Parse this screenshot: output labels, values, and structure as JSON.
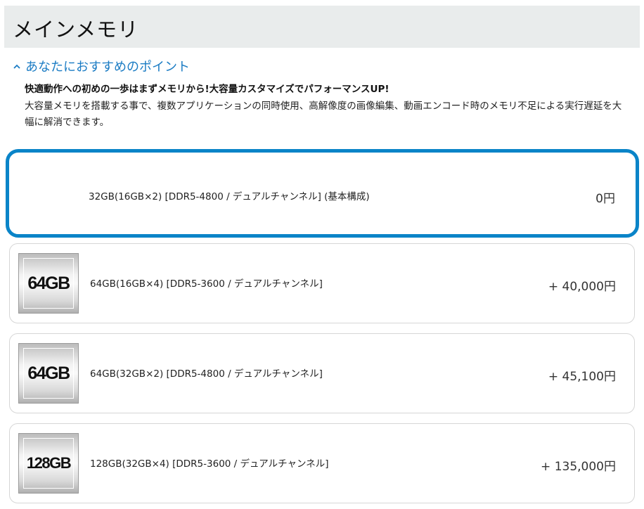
{
  "page": {
    "title": "メインメモリ"
  },
  "points": {
    "toggle_label": "あなたにおすすめのポイント",
    "lead": "快適動作への初めの一歩はまずメモリから!大容量カスタマイズでパフォーマンスUP!",
    "body": "大容量メモリを搭載する事で、複数アプリケーションの同時使用、高解像度の画像編集、動画エンコード時のメモリ不足による実行遅延を大幅に解消できます。"
  },
  "options": [
    {
      "label": "32GB(16GB×2) [DDR5-4800 / デュアルチャンネル] (基本構成)",
      "price": "0円",
      "badge": "",
      "selected": true
    },
    {
      "label": "64GB(16GB×4) [DDR5-3600 / デュアルチャンネル]",
      "price": "+ 40,000円",
      "badge": "64GB",
      "selected": false
    },
    {
      "label": "64GB(32GB×2) [DDR5-4800 / デュアルチャンネル]",
      "price": "+ 45,100円",
      "badge": "64GB",
      "selected": false
    },
    {
      "label": "128GB(32GB×4) [DDR5-3600 / デュアルチャンネル]",
      "price": "+ 135,000円",
      "badge": "128GB",
      "selected": false
    }
  ],
  "colors": {
    "accent": "#0a84c8",
    "link": "#1b7cc4",
    "header_bg": "#e9ecec"
  },
  "icons": {
    "toggle": "chevron-up-icon"
  }
}
